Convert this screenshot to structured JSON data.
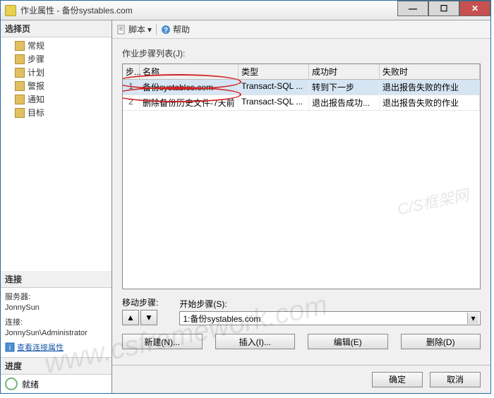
{
  "window": {
    "title": "作业属性 - 备份systables.com"
  },
  "sidebar": {
    "select_page_header": "选择页",
    "pages": [
      {
        "label": "常规"
      },
      {
        "label": "步骤"
      },
      {
        "label": "计划"
      },
      {
        "label": "警报"
      },
      {
        "label": "通知"
      },
      {
        "label": "目标"
      }
    ],
    "connection_header": "连接",
    "server_label": "服务器:",
    "server_value": "JonnySun",
    "connection_label": "连接:",
    "connection_value": "JonnySun\\Administrator",
    "view_conn_link": "查看连接属性",
    "progress_header": "进度",
    "progress_status": "就绪"
  },
  "toolbar": {
    "script_label": "脚本",
    "help_label": "帮助"
  },
  "main": {
    "steps_list_label": "作业步骤列表(J):",
    "columns": {
      "step": "步...",
      "name": "名称",
      "type": "类型",
      "on_success": "成功时",
      "on_fail": "失败时"
    },
    "rows": [
      {
        "step": "1",
        "name": "备份systables.com",
        "type": "Transact-SQL ...",
        "on_success": "转到下一步",
        "on_fail": "退出报告失败的作业"
      },
      {
        "step": "2",
        "name": "删除备份历史文件-7天前",
        "type": "Transact-SQL ...",
        "on_success": "退出报告成功...",
        "on_fail": "退出报告失败的作业"
      }
    ],
    "move_label": "移动步骤:",
    "start_label": "开始步骤(S):",
    "start_value": "1:备份systables.com",
    "buttons": {
      "new": "新建(N)...",
      "insert": "插入(I)...",
      "edit": "编辑(E)",
      "delete": "删除(D)"
    }
  },
  "footer": {
    "ok": "确定",
    "cancel": "取消"
  },
  "watermarks": {
    "url": "www.csframework.com",
    "brand": "C/S框架网"
  }
}
